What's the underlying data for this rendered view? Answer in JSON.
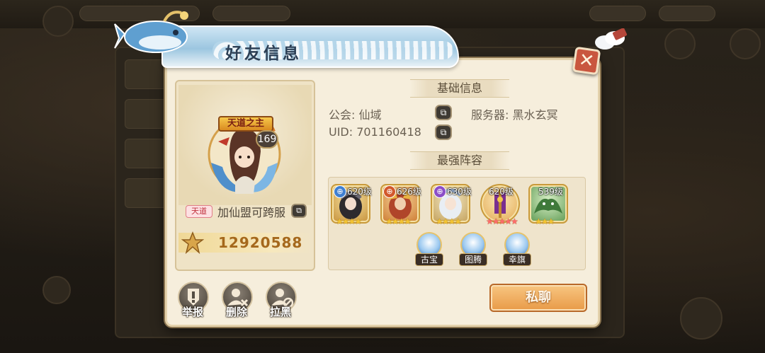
{
  "modal": {
    "title": "好友信息",
    "close_icon": "close-icon"
  },
  "profile": {
    "rank_title": "天道之主",
    "level": "169",
    "alliance_tag": "天道",
    "alliance_text": "加仙盟可跨服",
    "power": "12920588"
  },
  "basic_info": {
    "header": "基础信息",
    "guild_label": "公会: 仙域",
    "server_label": "服务器: 黑水玄冥",
    "uid_label": "UID: 701160418"
  },
  "lineup": {
    "header": "最强阵容",
    "heroes": [
      {
        "level": "620级",
        "faction_color": "#3f7fd1",
        "frame": "#e6b243"
      },
      {
        "level": "626级",
        "faction_color": "#d2582c",
        "frame": "#e6b243"
      },
      {
        "level": "630级",
        "faction_color": "#8b4ec7",
        "frame": "#e6b243"
      },
      {
        "level": "620级",
        "faction_color": "",
        "frame": "#e6b243"
      },
      {
        "level": "539级",
        "faction_color": "",
        "frame": "#e6b243"
      }
    ],
    "treasures": [
      {
        "label": "古宝"
      },
      {
        "label": "图腾"
      },
      {
        "label": "幸旗"
      }
    ]
  },
  "actions": {
    "report": "举报",
    "delete": "删除",
    "block": "拉黑",
    "private_chat": "私聊"
  },
  "colors": {
    "modal_bg": "#f6eedc",
    "accent_orange": "#e89a47",
    "power_gold": "#a5681c"
  }
}
